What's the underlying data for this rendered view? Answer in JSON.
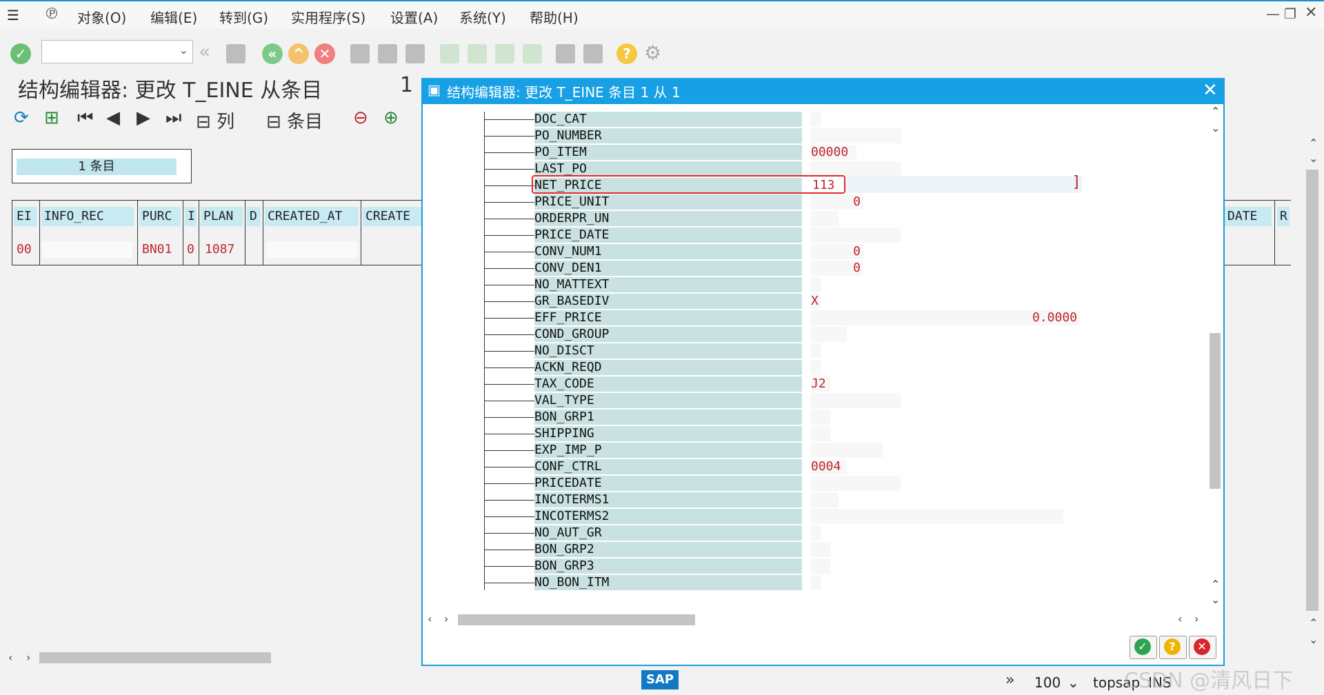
{
  "menubar": {
    "items": [
      "对象(O)",
      "编辑(E)",
      "转到(G)",
      "实用程序(S)",
      "设置(A)",
      "系统(Y)",
      "帮助(H)"
    ]
  },
  "page": {
    "title": "结构编辑器: 更改 T_EINE 从条目",
    "page_number": "1"
  },
  "app_toolbar": {
    "columns_label": "列",
    "entries_label": "条目"
  },
  "entries_box": {
    "label": "1 条目"
  },
  "grid": {
    "headers": [
      "EI",
      "INFO_REC",
      "PURC",
      "I",
      "PLAN",
      "D",
      "CREATED_AT",
      "CREATE"
    ],
    "row": [
      "00",
      "",
      "BN01",
      "0",
      "1087",
      "",
      "",
      ""
    ],
    "right_headers": [
      "DATE",
      "R"
    ]
  },
  "dialog": {
    "title": "结构编辑器: 更改 T_EINE 条目 1 从 1",
    "fields": [
      {
        "name": "DOC_CAT",
        "value": ""
      },
      {
        "name": "PO_NUMBER",
        "value": ""
      },
      {
        "name": "PO_ITEM",
        "value": "00000"
      },
      {
        "name": "LAST_PO",
        "value": ""
      },
      {
        "name": "NET_PRICE",
        "value": "113"
      },
      {
        "name": "PRICE_UNIT",
        "value": "0"
      },
      {
        "name": "ORDERPR_UN",
        "value": ""
      },
      {
        "name": "PRICE_DATE",
        "value": ""
      },
      {
        "name": "CONV_NUM1",
        "value": "0"
      },
      {
        "name": "CONV_DEN1",
        "value": "0"
      },
      {
        "name": "NO_MATTEXT",
        "value": ""
      },
      {
        "name": "GR_BASEDIV",
        "value": "X"
      },
      {
        "name": "EFF_PRICE",
        "value": "0.0000"
      },
      {
        "name": "COND_GROUP",
        "value": ""
      },
      {
        "name": "NO_DISCT",
        "value": ""
      },
      {
        "name": "ACKN_REQD",
        "value": ""
      },
      {
        "name": "TAX_CODE",
        "value": "J2"
      },
      {
        "name": "VAL_TYPE",
        "value": ""
      },
      {
        "name": "BON_GRP1",
        "value": ""
      },
      {
        "name": "SHIPPING",
        "value": ""
      },
      {
        "name": "EXP_IMP_P",
        "value": ""
      },
      {
        "name": "CONF_CTRL",
        "value": "0004"
      },
      {
        "name": "PRICEDATE",
        "value": ""
      },
      {
        "name": "INCOTERMS1",
        "value": ""
      },
      {
        "name": "INCOTERMS2",
        "value": ""
      },
      {
        "name": "NO_AUT_GR",
        "value": ""
      },
      {
        "name": "BON_GRP2",
        "value": ""
      },
      {
        "name": "BON_GRP3",
        "value": ""
      },
      {
        "name": "NO_BON_ITM",
        "value": ""
      }
    ]
  },
  "statusbar": {
    "logo": "SAP",
    "zoom": "100",
    "user": "topsap",
    "mode": "INS",
    "watermark": "CSDN @清风日下"
  },
  "colors": {
    "accent": "#17a0e4",
    "value_red": "#c0262d",
    "field_bg": "#c9e1e1",
    "highlight": "#e0282e"
  }
}
